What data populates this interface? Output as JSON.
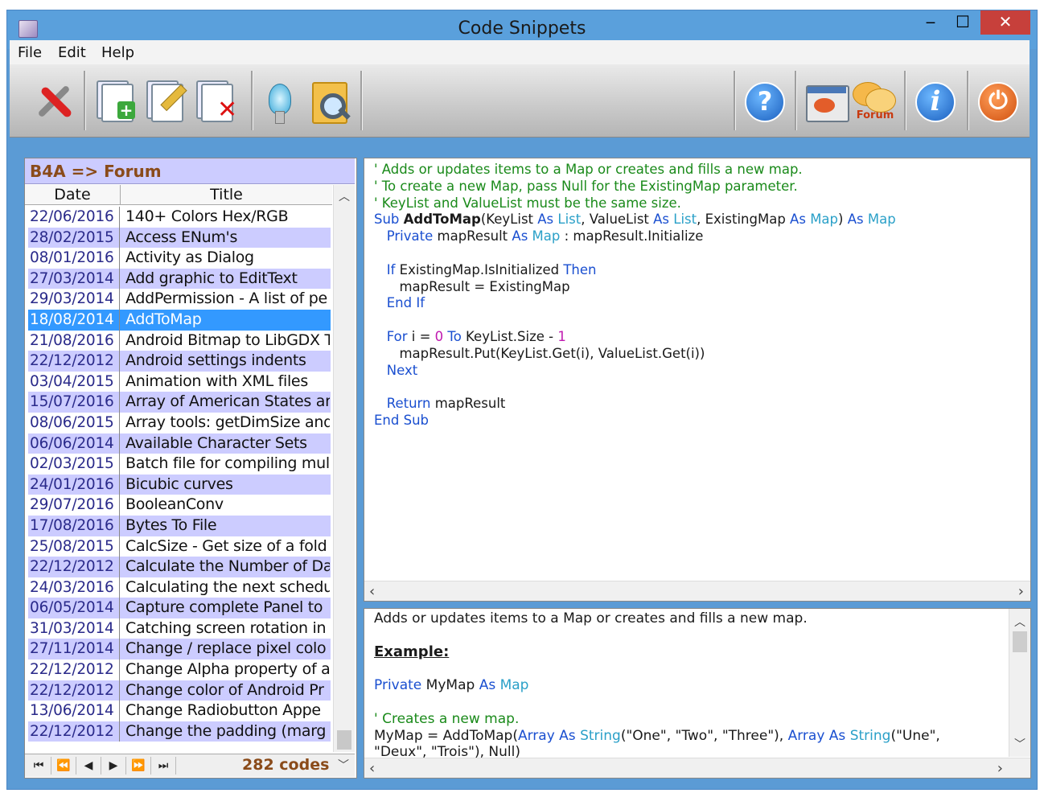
{
  "window": {
    "title": "Code Snippets",
    "minimize": "‒",
    "maximize": "☐",
    "close": "✕"
  },
  "menu": [
    "File",
    "Edit",
    "Help"
  ],
  "toolbar": {
    "left": [
      "tools-icon",
      "add-snippet-icon",
      "edit-snippet-icon",
      "delete-snippet-icon",
      "lamp-icon",
      "search-folder-icon"
    ],
    "right": [
      "help-icon",
      "browser-icon",
      "forum-icon",
      "info-icon",
      "power-icon"
    ],
    "forum_label": "Forum",
    "help_glyph": "?",
    "info_glyph": "i",
    "power_glyph": "⏻"
  },
  "list": {
    "title": "B4A => Forum",
    "columns": [
      "Date",
      "Title"
    ],
    "selected_index": 5,
    "rows": [
      {
        "date": "22/06/2016",
        "title": "140+ Colors Hex/RGB"
      },
      {
        "date": "28/02/2015",
        "title": "Access ENum's"
      },
      {
        "date": "08/01/2016",
        "title": "Activity as Dialog"
      },
      {
        "date": "27/03/2014",
        "title": "Add graphic to EditText"
      },
      {
        "date": "29/03/2014",
        "title": "AddPermission - A list of pe"
      },
      {
        "date": "18/08/2014",
        "title": "AddToMap"
      },
      {
        "date": "21/08/2016",
        "title": "Android Bitmap to LibGDX T"
      },
      {
        "date": "22/12/2012",
        "title": "Android settings indents"
      },
      {
        "date": "03/04/2015",
        "title": "Animation with XML files"
      },
      {
        "date": "15/07/2016",
        "title": "Array of American States ar"
      },
      {
        "date": "08/06/2015",
        "title": "Array tools: getDimSize and"
      },
      {
        "date": "06/06/2014",
        "title": "Available Character Sets"
      },
      {
        "date": "02/03/2015",
        "title": "Batch file for compiling mult"
      },
      {
        "date": "24/01/2016",
        "title": "Bicubic curves"
      },
      {
        "date": "29/07/2016",
        "title": "BooleanConv"
      },
      {
        "date": "17/08/2016",
        "title": "Bytes To File"
      },
      {
        "date": "25/08/2015",
        "title": "CalcSize - Get size of a fold"
      },
      {
        "date": "22/12/2012",
        "title": "Calculate the Number of Da"
      },
      {
        "date": "24/03/2016",
        "title": "Calculating the next schedu"
      },
      {
        "date": "06/05/2014",
        "title": "Capture complete Panel to"
      },
      {
        "date": "31/03/2014",
        "title": "Catching screen rotation in"
      },
      {
        "date": "27/11/2014",
        "title": "Change / replace pixel colo"
      },
      {
        "date": "22/12/2012",
        "title": "Change Alpha property of a"
      },
      {
        "date": "22/12/2012",
        "title": "Change color of Android Pr"
      },
      {
        "date": "13/06/2014",
        "title": "Change Radiobutton Appe"
      },
      {
        "date": "22/12/2012",
        "title": "Change the padding (marg"
      }
    ],
    "nav": [
      "⏮",
      "⏪",
      "◀",
      "▶",
      "⏩",
      "⏭"
    ],
    "count_label": "282 codes"
  },
  "code": {
    "lines": [
      [
        {
          "c": "cm",
          "t": "' Adds or updates items to a Map or creates and fills a new map."
        }
      ],
      [
        {
          "c": "cm",
          "t": "' To create a new Map, pass Null for the ExistingMap parameter."
        }
      ],
      [
        {
          "c": "cm",
          "t": "' KeyList and ValueList must be the same size."
        }
      ],
      [
        {
          "c": "kw",
          "t": "Sub "
        },
        {
          "c": "b",
          "t": "AddToMap"
        },
        {
          "c": "",
          "t": "(KeyList "
        },
        {
          "c": "kw",
          "t": "As "
        },
        {
          "c": "ty",
          "t": "List"
        },
        {
          "c": "",
          "t": ", ValueList "
        },
        {
          "c": "kw",
          "t": "As "
        },
        {
          "c": "ty",
          "t": "List"
        },
        {
          "c": "",
          "t": ", ExistingMap "
        },
        {
          "c": "kw",
          "t": "As "
        },
        {
          "c": "ty",
          "t": "Map"
        },
        {
          "c": "",
          "t": ") "
        },
        {
          "c": "kw",
          "t": "As "
        },
        {
          "c": "ty",
          "t": "Map"
        }
      ],
      [
        {
          "c": "kw",
          "t": "   Private "
        },
        {
          "c": "",
          "t": "mapResult "
        },
        {
          "c": "kw",
          "t": "As "
        },
        {
          "c": "ty",
          "t": "Map"
        },
        {
          "c": "",
          "t": " : mapResult.Initialize"
        }
      ],
      [
        {
          "c": "",
          "t": ""
        }
      ],
      [
        {
          "c": "kw",
          "t": "   If "
        },
        {
          "c": "",
          "t": "ExistingMap.IsInitialized "
        },
        {
          "c": "kw",
          "t": "Then"
        }
      ],
      [
        {
          "c": "",
          "t": "      mapResult = ExistingMap"
        }
      ],
      [
        {
          "c": "kw",
          "t": "   End If"
        }
      ],
      [
        {
          "c": "",
          "t": ""
        }
      ],
      [
        {
          "c": "kw",
          "t": "   For "
        },
        {
          "c": "",
          "t": "i = "
        },
        {
          "c": "num",
          "t": "0"
        },
        {
          "c": "kw",
          "t": " To "
        },
        {
          "c": "",
          "t": "KeyList.Size - "
        },
        {
          "c": "num",
          "t": "1"
        }
      ],
      [
        {
          "c": "",
          "t": "      mapResult.Put(KeyList.Get(i), ValueList.Get(i))"
        }
      ],
      [
        {
          "c": "kw",
          "t": "   Next"
        }
      ],
      [
        {
          "c": "",
          "t": ""
        }
      ],
      [
        {
          "c": "kw",
          "t": "   Return "
        },
        {
          "c": "",
          "t": "mapResult"
        }
      ],
      [
        {
          "c": "kw",
          "t": "End Sub"
        }
      ]
    ]
  },
  "description": {
    "lines": [
      [
        {
          "c": "",
          "t": "Adds or updates items to a Map or creates and fills a new map."
        }
      ],
      [
        {
          "c": "",
          "t": ""
        }
      ],
      [
        {
          "c": "ex",
          "t": "Example:"
        }
      ],
      [
        {
          "c": "",
          "t": ""
        }
      ],
      [
        {
          "c": "kw",
          "t": "Private "
        },
        {
          "c": "",
          "t": "MyMap "
        },
        {
          "c": "kw",
          "t": "As "
        },
        {
          "c": "ty",
          "t": "Map"
        }
      ],
      [
        {
          "c": "",
          "t": ""
        }
      ],
      [
        {
          "c": "cm",
          "t": "' Creates a new map."
        }
      ],
      [
        {
          "c": "",
          "t": "MyMap = AddToMap("
        },
        {
          "c": "kw",
          "t": "Array As "
        },
        {
          "c": "ty",
          "t": "String"
        },
        {
          "c": "",
          "t": "(\"One\", \"Two\", \"Three\"), "
        },
        {
          "c": "kw",
          "t": "Array As "
        },
        {
          "c": "ty",
          "t": "String"
        },
        {
          "c": "",
          "t": "(\"Une\","
        }
      ],
      [
        {
          "c": "",
          "t": "\"Deux\", \"Trois\"), Null)"
        }
      ]
    ]
  },
  "scroll": {
    "left": "‹",
    "right": "›",
    "up": "︿",
    "down": "﹀"
  }
}
